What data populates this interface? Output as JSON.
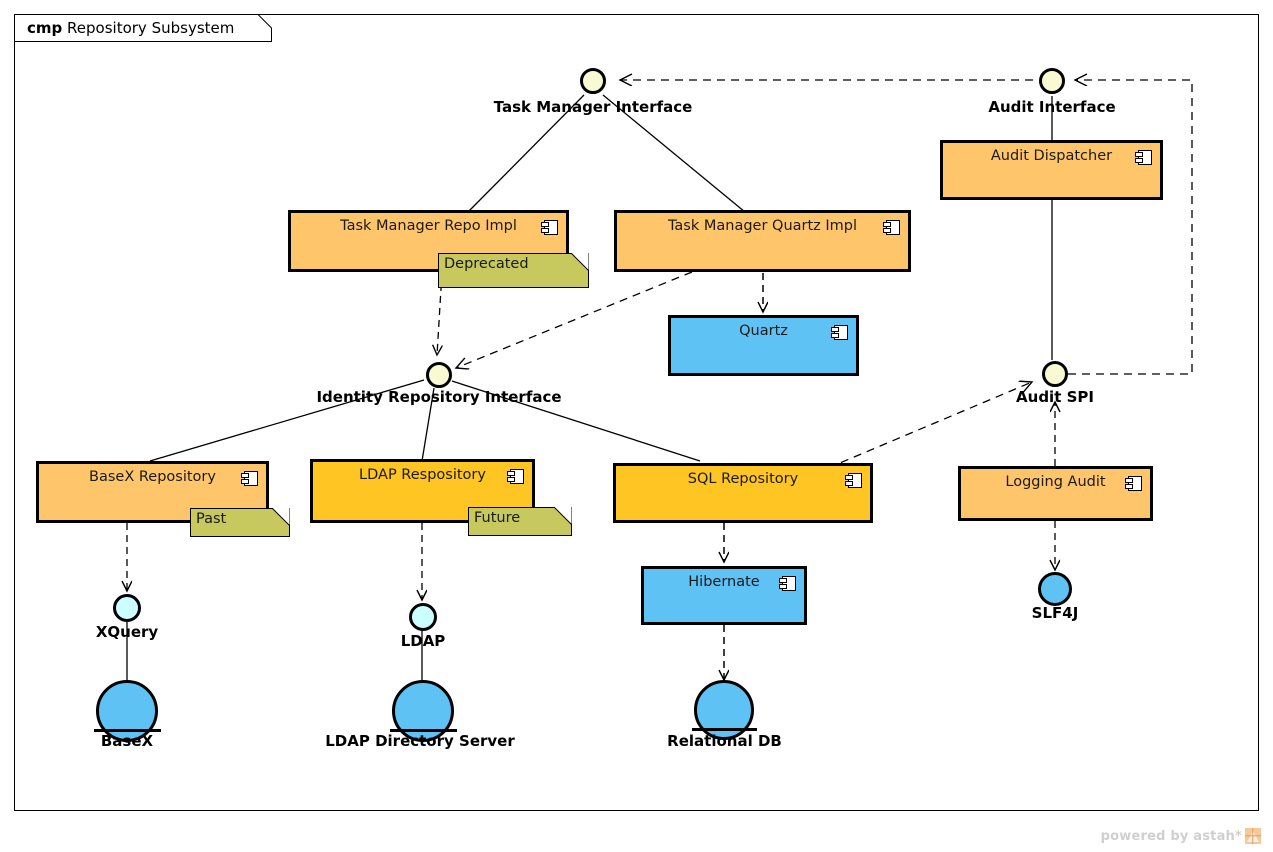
{
  "frame": {
    "keyword": "cmp",
    "title": "Repository Subsystem"
  },
  "interfaces": [
    {
      "id": "task-manager-interface",
      "label": "Task Manager Interface"
    },
    {
      "id": "audit-interface",
      "label": "Audit Interface"
    },
    {
      "id": "identity-repository-interface",
      "label": "Identity Repository Interface"
    },
    {
      "id": "audit-spi",
      "label": "Audit SPI"
    }
  ],
  "components": [
    {
      "id": "task-manager-repo-impl",
      "label": "Task Manager Repo Impl",
      "color": "#FFC56B"
    },
    {
      "id": "task-manager-quartz-impl",
      "label": "Task Manager Quartz Impl",
      "color": "#FFC56B"
    },
    {
      "id": "audit-dispatcher",
      "label": "Audit Dispatcher",
      "color": "#FFC56B"
    },
    {
      "id": "quartz",
      "label": "Quartz",
      "color": "#5FC2F5"
    },
    {
      "id": "basex-repository",
      "label": "BaseX Repository",
      "color": "#FFC56B"
    },
    {
      "id": "ldap-respository",
      "label": "LDAP Respository",
      "color": "#FFC523"
    },
    {
      "id": "sql-repository",
      "label": "SQL Repository",
      "color": "#FFC523"
    },
    {
      "id": "logging-audit",
      "label": "Logging Audit",
      "color": "#FFC56B"
    },
    {
      "id": "hibernate",
      "label": "Hibernate",
      "color": "#5FC2F5"
    }
  ],
  "notes": [
    {
      "id": "note-deprecated",
      "label": "Deprecated",
      "color": "#C7C95E"
    },
    {
      "id": "note-past",
      "label": "Past",
      "color": "#C7C95E"
    },
    {
      "id": "note-future",
      "label": "Future",
      "color": "#C7C95E"
    }
  ],
  "artifacts": [
    {
      "id": "xquery",
      "label": "XQuery",
      "color": "#CCFFFF"
    },
    {
      "id": "ldap",
      "label": "LDAP",
      "color": "#CCFFFF"
    },
    {
      "id": "slf4j",
      "label": "SLF4J",
      "color": "#5FC2F5"
    }
  ],
  "nodes": [
    {
      "id": "basex",
      "label": "BaseX",
      "color": "#5FC2F5"
    },
    {
      "id": "ldap-directory-server",
      "label": "LDAP Directory Server",
      "color": "#5FC2F5"
    },
    {
      "id": "relational-db",
      "label": "Relational DB",
      "color": "#5FC2F5"
    }
  ],
  "watermark": {
    "text": "powered by astah*",
    "logo": "astah-logo-icon"
  },
  "palette": {
    "component_orange": "#FFC56B",
    "component_gold": "#FFC523",
    "component_blue": "#5FC2F5",
    "note_olive": "#C7C95E",
    "interface_ball": "#FAFAD2",
    "artifact_cyan": "#CCFFFF",
    "stroke": "#000000",
    "background": "#FFFFFF"
  }
}
